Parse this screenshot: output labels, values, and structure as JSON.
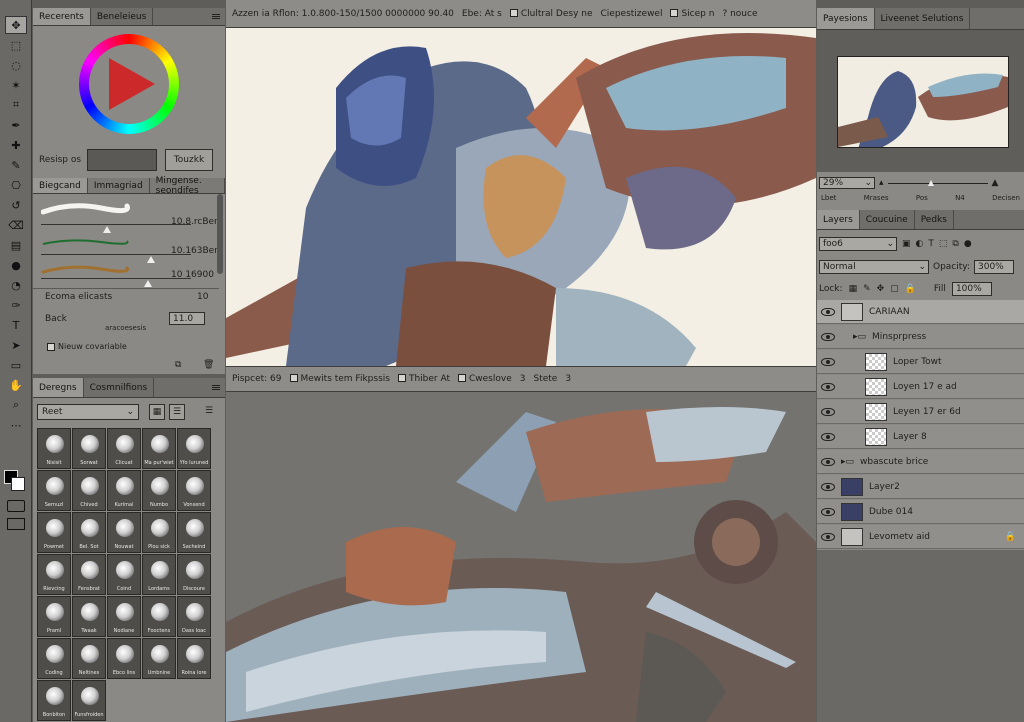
{
  "colors": {
    "accent_selection": "#a9a8a4",
    "panel": "#8a8985",
    "frame": "#5e5d59"
  },
  "tools": [
    "move-tool-icon",
    "marquee-icon",
    "lasso-icon",
    "magic-wand-icon",
    "crop-icon",
    "eyedropper-icon",
    "healing-icon",
    "brush-icon",
    "stamp-icon",
    "history-brush-icon",
    "eraser-icon",
    "gradient-icon",
    "blur-icon",
    "dodge-icon",
    "pen-icon",
    "type-icon",
    "path-select-icon",
    "shape-icon",
    "hand-icon",
    "zoom-icon",
    "more-tools-icon"
  ],
  "left_top": {
    "tabs": [
      "Recerents",
      "Beneleieus"
    ],
    "size_label": "Resisp os",
    "size_button": "Touzkk",
    "subtabs": [
      "Biegcand",
      "Immagriad",
      "Mingense. seondifes"
    ],
    "strokes": [
      {
        "value": "10.8.rcBer",
        "slider": 0.44
      },
      {
        "value": "10.163Ber",
        "slider": 0.73
      },
      {
        "value": "10 16900",
        "slider": 0.71
      }
    ],
    "opt1_label": "Ecoma elicasts",
    "opt1_value": "10",
    "opt2_label": "Back",
    "opt2_value": "11.0",
    "opt2_sublabel": "aracoesesis",
    "checkbox_label": "Nieuw covariable"
  },
  "left_bottom": {
    "tabs": [
      "Deregns",
      "Cosmnilfions"
    ],
    "preset": "Reet",
    "brushes": [
      "Nisisit",
      "Sorwat",
      "Clicuat",
      "Ma pur'wiet",
      "Yfo luruned",
      "Sernuzl",
      "Chived",
      "Kurimal",
      "Numbo",
      "Vonsend",
      "Powmet",
      "Bel. Sot",
      "Nouwat",
      "Plou sick",
      "Sacheind",
      "Rievcing",
      "Fensbrat",
      "Coind",
      "Lordams",
      "Discoure",
      "Praml",
      "Twaak",
      "Nodiane",
      "Fooctens",
      "Dass loac",
      "Coding",
      "Neltines",
      "Ebco lins",
      "Umbnine",
      "Roina lore",
      "Bonbiton",
      "Funsfroiden"
    ]
  },
  "status": {
    "file_info": "Azzen ia Rflon: 1.0.800-150/1500 0000000 90.40",
    "item1": "Ebe: At s",
    "item2": "Clultral Desy ne",
    "item3": "Ciepestizewel",
    "item4": "Sicep n",
    "item5": "? nouce"
  },
  "mid_bar": {
    "zoom_label": "Pispcet: 69",
    "opt1": "Mewits tem Fikpssis",
    "opt2": "Thiber At",
    "opt3": "Cweslove",
    "opt3_num": "3",
    "opt4": "Stete",
    "opt4_num": "3"
  },
  "right": {
    "nav_tabs": [
      "Payesions",
      "Liveenet Selutions"
    ],
    "zoom": "29%",
    "color_labels": [
      "Lbet",
      "Mrases",
      "Pos",
      "N4",
      "Decisen"
    ],
    "layer_tabs": [
      "Layers",
      "Coucuine",
      "Pedks"
    ],
    "kind_filter": "foo6",
    "blend_mode": "Normal",
    "opacity_label": "Opacity:",
    "opacity_value": "300%",
    "lock_label": "Lock:",
    "fill_label": "Fill",
    "fill_value": "100%",
    "layers": [
      {
        "name": "CARIAAN",
        "indent": 0,
        "thumb": "plain",
        "selected": true
      },
      {
        "name": "Minsprpress",
        "indent": 1,
        "thumb": "folder"
      },
      {
        "name": "Loper Towt",
        "indent": 2,
        "thumb": "checker"
      },
      {
        "name": "Loyen 17 e ad",
        "indent": 2,
        "thumb": "checker"
      },
      {
        "name": "Leyen 17 er 6d",
        "indent": 2,
        "thumb": "checker"
      },
      {
        "name": "Layer 8",
        "indent": 2,
        "thumb": "checker"
      },
      {
        "name": "wbascute brice",
        "indent": 0,
        "thumb": "folder"
      },
      {
        "name": "Layer2",
        "indent": 0,
        "thumb": "dark"
      },
      {
        "name": "Dube 014",
        "indent": 0,
        "thumb": "dark"
      },
      {
        "name": "Levometv aid",
        "indent": 0,
        "thumb": "plain",
        "locked": true
      }
    ]
  }
}
